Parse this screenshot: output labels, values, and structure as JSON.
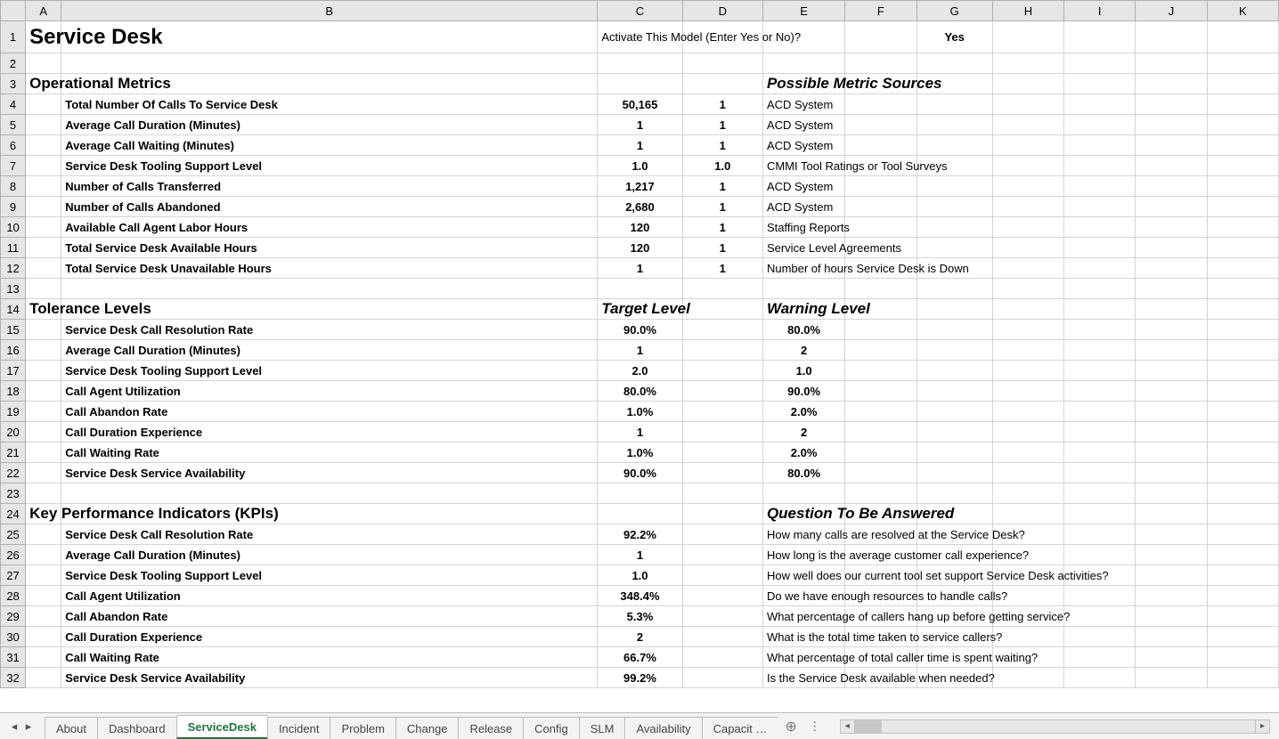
{
  "cols": [
    "A",
    "B",
    "C",
    "D",
    "E",
    "F",
    "G",
    "H",
    "I",
    "J",
    "K"
  ],
  "title": "Service Desk",
  "activate_prompt": "Activate This Model (Enter Yes or No)?",
  "activate_value": "Yes",
  "section_op": "Operational Metrics",
  "section_op_src": "Possible Metric Sources",
  "op_rows": [
    {
      "label": "Total Number Of Calls To Service Desk",
      "c": "50,165",
      "d": "1",
      "src": "ACD System"
    },
    {
      "label": "Average Call Duration (Minutes)",
      "c": "1",
      "d": "1",
      "src": "ACD System"
    },
    {
      "label": "Average Call Waiting (Minutes)",
      "c": "1",
      "d": "1",
      "src": "ACD System"
    },
    {
      "label": "Service Desk Tooling Support Level",
      "c": "1.0",
      "d": "1.0",
      "src": "CMMI Tool Ratings or Tool Surveys"
    },
    {
      "label": "Number of Calls Transferred",
      "c": "1,217",
      "d": "1",
      "src": "ACD System"
    },
    {
      "label": "Number of Calls Abandoned",
      "c": "2,680",
      "d": "1",
      "src": "ACD System"
    },
    {
      "label": "Available Call Agent Labor Hours",
      "c": "120",
      "d": "1",
      "src": "Staffing Reports"
    },
    {
      "label": "Total Service Desk Available Hours",
      "c": "120",
      "d": "1",
      "src": "Service Level Agreements"
    },
    {
      "label": "Total Service Desk Unavailable Hours",
      "c": "1",
      "d": "1",
      "src": "Number of hours Service Desk is Down"
    }
  ],
  "section_tol": "Tolerance Levels",
  "tol_target": "Target Level",
  "tol_warn": "Warning Level",
  "tol_rows": [
    {
      "label": "Service Desk Call Resolution Rate",
      "t": "90.0%",
      "w": "80.0%"
    },
    {
      "label": "Average Call Duration (Minutes)",
      "t": "1",
      "w": "2"
    },
    {
      "label": "Service Desk Tooling Support Level",
      "t": "2.0",
      "w": "1.0"
    },
    {
      "label": "Call Agent Utilization",
      "t": "80.0%",
      "w": "90.0%"
    },
    {
      "label": "Call Abandon Rate",
      "t": "1.0%",
      "w": "2.0%"
    },
    {
      "label": "Call Duration Experience",
      "t": "1",
      "w": "2"
    },
    {
      "label": "Call Waiting Rate",
      "t": "1.0%",
      "w": "2.0%"
    },
    {
      "label": "Service Desk Service Availability",
      "t": "90.0%",
      "w": "80.0%"
    }
  ],
  "section_kpi": "Key Performance Indicators (KPIs)",
  "kpi_q": "Question To Be Answered",
  "kpi_rows": [
    {
      "label": "Service Desk Call Resolution Rate",
      "v": "92.2%",
      "cls": "green",
      "q": "How many calls are resolved at the Service Desk?"
    },
    {
      "label": "Average Call Duration (Minutes)",
      "v": "1",
      "cls": "red",
      "q": "How long is the average customer call experience?"
    },
    {
      "label": "Service Desk Tooling Support Level",
      "v": "1.0",
      "cls": "yellow",
      "q": "How well does our current tool set support Service Desk activities?"
    },
    {
      "label": "Call Agent Utilization",
      "v": "348.4%",
      "cls": "red",
      "q": "Do we have enough resources to handle calls?"
    },
    {
      "label": "Call Abandon Rate",
      "v": "5.3%",
      "cls": "red",
      "q": "What percentage of callers hang up before getting service?"
    },
    {
      "label": "Call Duration Experience",
      "v": "2",
      "cls": "yellow",
      "q": "What is the total time taken to service callers?"
    },
    {
      "label": "Call Waiting Rate",
      "v": "66.7%",
      "cls": "red",
      "q": "What percentage of total caller time is spent waiting?"
    },
    {
      "label": "Service Desk Service Availability",
      "v": "99.2%",
      "cls": "green",
      "q": "Is the Service Desk available when needed?"
    }
  ],
  "tabs": [
    "About",
    "Dashboard",
    "ServiceDesk",
    "Incident",
    "Problem",
    "Change",
    "Release",
    "Config",
    "SLM",
    "Availability",
    "Capacit …"
  ],
  "active_tab": "ServiceDesk"
}
